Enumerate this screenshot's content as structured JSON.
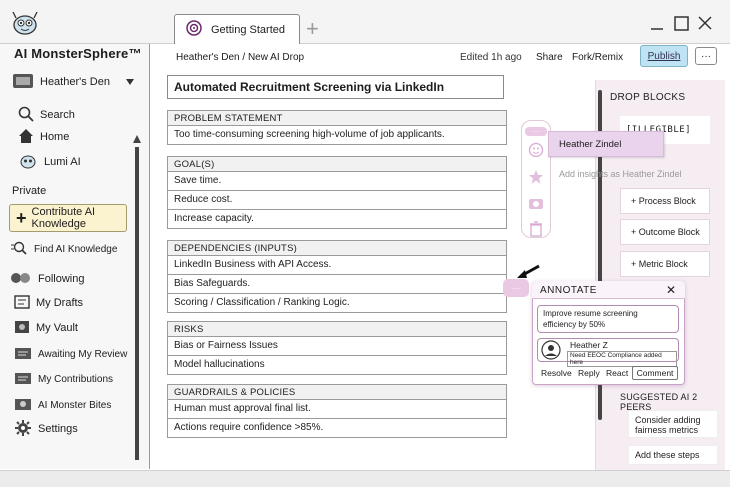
{
  "tabs": {
    "active_label": "Getting Started"
  },
  "sidebar": {
    "app_title": "AI MonsterSphere™",
    "workspace": "Heather's Den",
    "nav": [
      {
        "label": "Search",
        "icon": "search-icon"
      },
      {
        "label": "Home",
        "icon": "home-icon"
      },
      {
        "label": "Lumi AI",
        "icon": "lumi-icon"
      }
    ],
    "private_label": "Private",
    "contribute_label": "Contribute AI Knowledge",
    "private_items": [
      {
        "label": "Find AI Knowledge",
        "icon": "find-icon"
      },
      {
        "label": "Following",
        "icon": "following-icon"
      },
      {
        "label": "My Drafts",
        "icon": "drafts-icon"
      },
      {
        "label": "My Vault",
        "icon": "vault-icon"
      },
      {
        "label": "Awaiting My Review",
        "icon": "review-icon"
      },
      {
        "label": "My Contributions",
        "icon": "contributions-icon"
      },
      {
        "label": "AI Monster Bites",
        "icon": "bites-icon"
      },
      {
        "label": "Settings",
        "icon": "gear-icon"
      }
    ]
  },
  "header": {
    "breadcrumb": "Heather's Den / New AI Drop",
    "edited": "Edited 1h ago",
    "share": "Share",
    "fork": "Fork/Remix",
    "publish": "Publish",
    "more": "···"
  },
  "doc": {
    "title": "Automated Recruitment Screening via LinkedIn",
    "sections": [
      {
        "heading": "PROBLEM STATEMENT",
        "rows": [
          "Too time-consuming screening high-volume of job applicants."
        ]
      },
      {
        "heading": "GOAL(S)",
        "rows": [
          "Save time.",
          "Reduce cost.",
          "Increase capacity."
        ]
      },
      {
        "heading": "DEPENDENCIES (INPUTS)",
        "rows": [
          "LinkedIn Business with API Access.",
          "Bias Safeguards.",
          "Scoring / Classification / Ranking Logic."
        ]
      },
      {
        "heading": "RISKS",
        "rows": [
          "Bias or Fairness Issues",
          "Model hallucinations"
        ]
      },
      {
        "heading": "GUARDRAILS & POLICIES",
        "rows": [
          "Human must approval final list.",
          "Actions require confidence >85%."
        ]
      }
    ]
  },
  "drop_blocks": {
    "title": "DROP BLOCKS",
    "illegible": "[ILLEGIBLE]",
    "blocks": [
      "+ Process Block",
      "+ Outcome Block",
      "+ Metric Block"
    ]
  },
  "suggested": {
    "title": "SUGGESTED AI 2 PEERS",
    "items": [
      "Consider adding fairness metrics",
      "Add these steps"
    ]
  },
  "insights": {
    "user": "Heather Zindel",
    "placeholder": "Add insights as Heather Zindel"
  },
  "annotate": {
    "title": "ANNOTATE",
    "text": "Improve resume screening efficiency by 50%",
    "user": "Heather Z",
    "note": "Need EEOC Compliance added here",
    "actions": [
      "Resolve",
      "Reply",
      "React"
    ],
    "comment": "Comment"
  },
  "colors": {
    "publish": "#bfe3f2",
    "panel": "#f6edf3",
    "accent": "#e9c9e4",
    "contribute": "#fbf2cf"
  }
}
